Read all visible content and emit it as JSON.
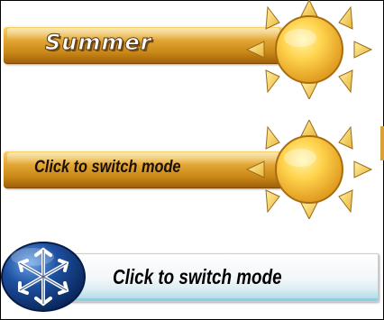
{
  "buttons": {
    "summer": {
      "label": "Summer"
    },
    "summer_hover": {
      "label": "Click to switch mode"
    },
    "winter_hover": {
      "label": "Click to switch mode"
    }
  },
  "colors": {
    "gold_bar": "#e4a936",
    "sun_fill": "#ffd34d",
    "snow_badge": "#1d4f9f",
    "winter_bar_edge": "#8ccfe3"
  },
  "icons": {
    "summer": "sun-icon",
    "winter": "snowflake-icon"
  }
}
